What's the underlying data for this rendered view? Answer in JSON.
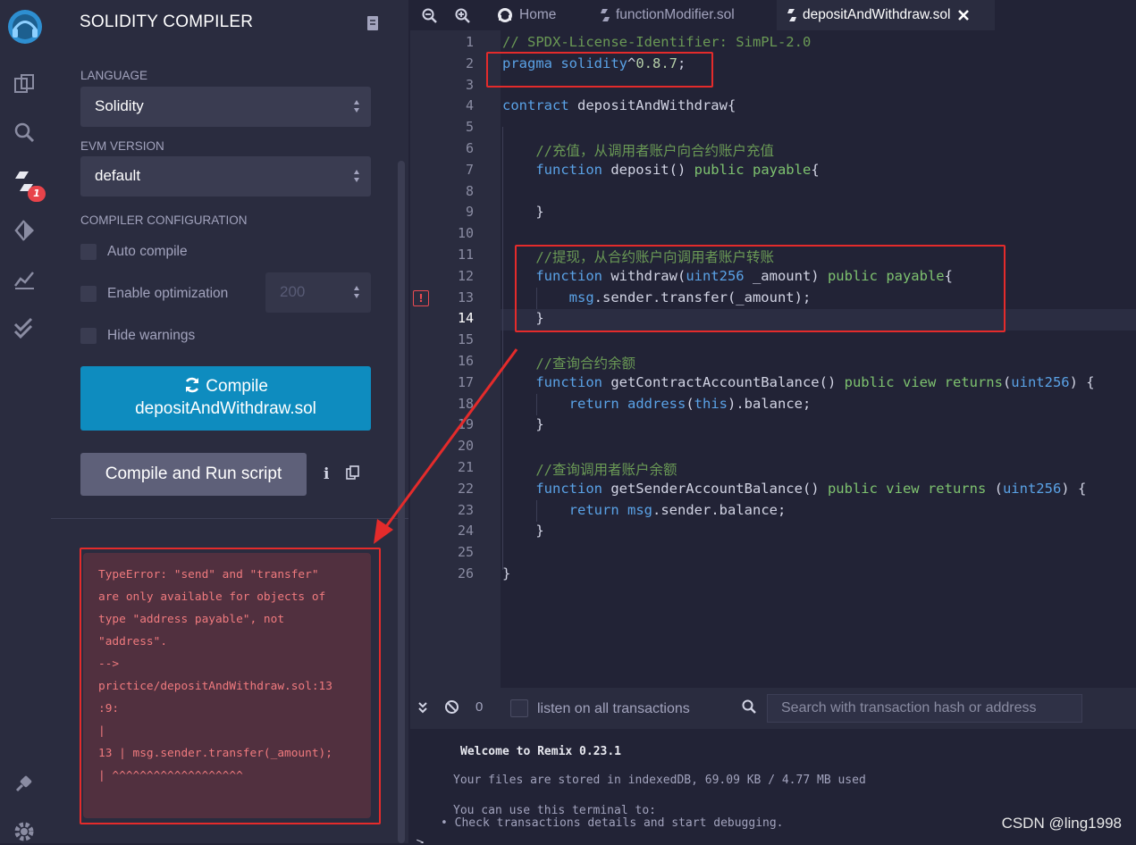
{
  "sidebar_icons": [
    "remix-logo-icon",
    "file-explorer-icon",
    "search-icon",
    "solidity-compiler-icon",
    "deploy-run-icon",
    "analysis-icon",
    "verification-icon",
    "plugin-manager-icon",
    "settings-icon"
  ],
  "compiler_badge": "1",
  "panel": {
    "title": "SOLIDITY COMPILER",
    "language_label": "LANGUAGE",
    "language_value": "Solidity",
    "evm_label": "EVM VERSION",
    "evm_value": "default",
    "config_label": "COMPILER CONFIGURATION",
    "auto_compile": "Auto compile",
    "enable_optimization": "Enable optimization",
    "optimization_runs": "200",
    "hide_warnings": "Hide warnings",
    "compile_line1": "Compile",
    "compile_line2": "depositAndWithdraw.sol",
    "run_script": "Compile and Run script",
    "error_text": "TypeError: \"send\" and \"transfer\"\nare only available for objects of\ntype \"address payable\", not\n\"address\".\n-->\nprictice/depositAndWithdraw.sol:13\n:9:\n|\n13 | msg.sender.transfer(_amount);\n| ^^^^^^^^^^^^^^^^^^^"
  },
  "tabs": [
    {
      "label": "Home"
    },
    {
      "label": "functionModifier.sol"
    },
    {
      "label": "depositAndWithdraw.sol"
    }
  ],
  "editor": {
    "line_numbers": [
      "1",
      "2",
      "3",
      "4",
      "5",
      "6",
      "7",
      "8",
      "9",
      "10",
      "11",
      "12",
      "13",
      "14",
      "15",
      "16",
      "17",
      "18",
      "19",
      "20",
      "21",
      "22",
      "23",
      "24",
      "25",
      "26"
    ],
    "error_line": "13",
    "current_line": "14"
  },
  "code_lines": [
    "// SPDX-License-Identifier: SimPL-2.0",
    "pragma solidity^0.8.7;",
    "",
    "contract depositAndWithdraw{",
    "",
    "    //充值，从调用者账户向合约账户充值",
    "    function deposit() public payable{",
    "",
    "    }",
    "",
    "    //提现，从合约账户向调用者账户转账",
    "    function withdraw(uint256 _amount) public payable{",
    "        msg.sender.transfer(_amount);",
    "    }",
    "",
    "    //查询合约余额",
    "    function getContractAccountBalance() public view returns(uint256) {",
    "        return address(this).balance;",
    "    }",
    "",
    "    //查询调用者账户余额",
    "    function getSenderAccountBalance() public view returns (uint256) {",
    "        return msg.sender.balance;",
    "    }",
    "",
    "}"
  ],
  "terminal": {
    "pending_count": "0",
    "listen_label": "listen on all transactions",
    "search_placeholder": "Search with transaction hash or address",
    "welcome": "Welcome to Remix 0.23.1",
    "storage": "Your files are stored in indexedDB, 69.09 KB / 4.77 MB used",
    "can_use": "You can use this terminal to:",
    "bullet": "• Check transactions details and start debugging."
  },
  "watermark": "CSDN @ling1998",
  "colors": {
    "accent": "#0e8cbf",
    "error": "#f07a7e",
    "highlight": "#e42b2b"
  }
}
